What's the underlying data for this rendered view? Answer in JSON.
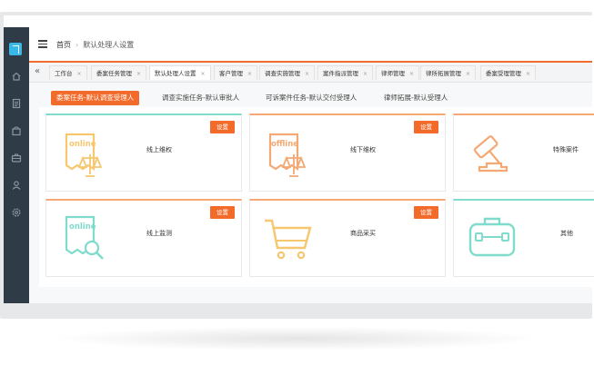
{
  "breadcrumb": {
    "home": "首页",
    "separator": "›",
    "current": "默认处理人设置"
  },
  "tabs": [
    {
      "label": "工作台",
      "active": false
    },
    {
      "label": "委案任务管理",
      "active": false
    },
    {
      "label": "默认处理人设置",
      "active": true
    },
    {
      "label": "客户管理",
      "active": false
    },
    {
      "label": "调查实施管理",
      "active": false
    },
    {
      "label": "案件指派管理",
      "active": false
    },
    {
      "label": "律师管理",
      "active": false
    },
    {
      "label": "律所拓展管理",
      "active": false
    },
    {
      "label": "委案受理管理",
      "active": false
    }
  ],
  "tab_close": "×",
  "tab_collapse": "«",
  "subtabs": [
    {
      "label": "委案任务-默认调查受理人",
      "active": true
    },
    {
      "label": "调查实施任务-默认审批人",
      "active": false
    },
    {
      "label": "可诉案件任务-默认交付受理人",
      "active": false
    },
    {
      "label": "律师拓展-默认受理人",
      "active": false
    }
  ],
  "cards": [
    {
      "title": "线上维权",
      "button": "设置",
      "icon_text": "online",
      "icon": "online-document-scales-icon",
      "accent": "#f6c76f"
    },
    {
      "title": "线下维权",
      "button": "设置",
      "icon_text": "offline",
      "icon": "offline-document-scales-icon",
      "accent": "#f4a873"
    },
    {
      "title": "特殊案件",
      "button": "",
      "icon": "gavel-icon",
      "accent": "#f4a873"
    },
    {
      "title": "线上监测",
      "button": "设置",
      "icon_text": "online",
      "icon": "online-document-search-icon",
      "accent": "#f6c76f"
    },
    {
      "title": "商品采买",
      "button": "设置",
      "icon": "shopping-cart-icon",
      "accent": "#f4a873"
    },
    {
      "title": "其他",
      "button": "",
      "icon": "toolbox-icon",
      "accent": "#7fdccc"
    }
  ],
  "colors": {
    "primary": "#f26b2a",
    "sidebar": "#2f3b47",
    "logo": "#39b7e6",
    "yellow": "#f6c76f",
    "orange": "#f4a873",
    "teal": "#7fdccc"
  },
  "sidebar_icons": [
    "home-icon",
    "document-icon",
    "bag-icon",
    "briefcase-icon",
    "user-icon",
    "settings-icon"
  ]
}
